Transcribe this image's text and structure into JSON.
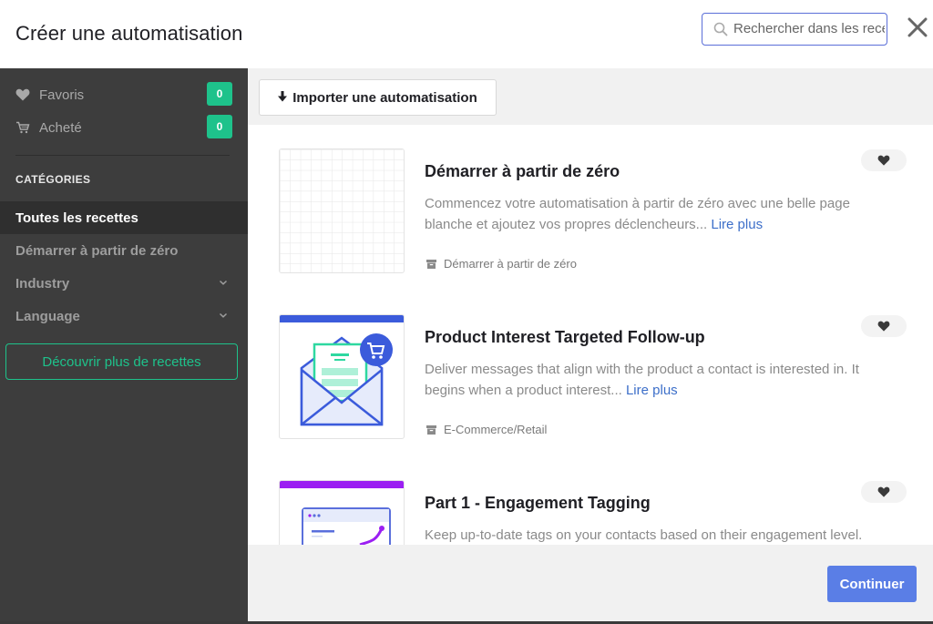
{
  "header": {
    "title": "Créer une automatisation",
    "search_placeholder": "Rechercher dans les recettes",
    "search_value": "",
    "close_icon": "close-icon"
  },
  "sidebar": {
    "favorites": {
      "label": "Favoris",
      "count": "0",
      "icon": "heart-icon"
    },
    "purchased": {
      "label": "Acheté",
      "count": "0",
      "icon": "cart-icon"
    },
    "categories_heading": "CATÉGORIES",
    "categories": [
      {
        "label": "Toutes les recettes",
        "active": true,
        "expandable": false
      },
      {
        "label": "Démarrer à partir de zéro",
        "active": false,
        "expandable": false
      },
      {
        "label": "Industry",
        "active": false,
        "expandable": true
      },
      {
        "label": "Language",
        "active": false,
        "expandable": true
      }
    ],
    "discover_label": "Découvrir plus de recettes"
  },
  "toolbar": {
    "import_label": "Importer une automatisation",
    "import_icon": "download-arrow-icon"
  },
  "recipes": [
    {
      "title": "Démarrer à partir de zéro",
      "description": "Commencez votre automatisation à partir de zéro avec une belle page blanche et ajoutez vos propres déclencheurs...",
      "read_more": "Lire plus",
      "category": "Démarrer à partir de zéro",
      "thumbnail": "blank-grid"
    },
    {
      "title": "Product Interest Targeted Follow-up",
      "description": "Deliver messages that align with the product a contact is interested in. It begins when a product interest...",
      "read_more": "Lire plus",
      "category": "E-Commerce/Retail",
      "thumbnail": "envelope-cart",
      "accent": "#3b5bdb"
    },
    {
      "title": "Part 1 - Engagement Tagging",
      "description": "Keep up-to-date tags on your contacts based on their engagement level.",
      "read_more": "",
      "category": "",
      "thumbnail": "browser-chart",
      "accent": "#9b1ff2"
    }
  ],
  "footer": {
    "continue_label": "Continuer"
  },
  "colors": {
    "accent_green": "#1ec28b",
    "primary_blue": "#5a7ee6",
    "link_blue": "#3d6fc9",
    "sidebar_bg": "#3d3d3d"
  }
}
